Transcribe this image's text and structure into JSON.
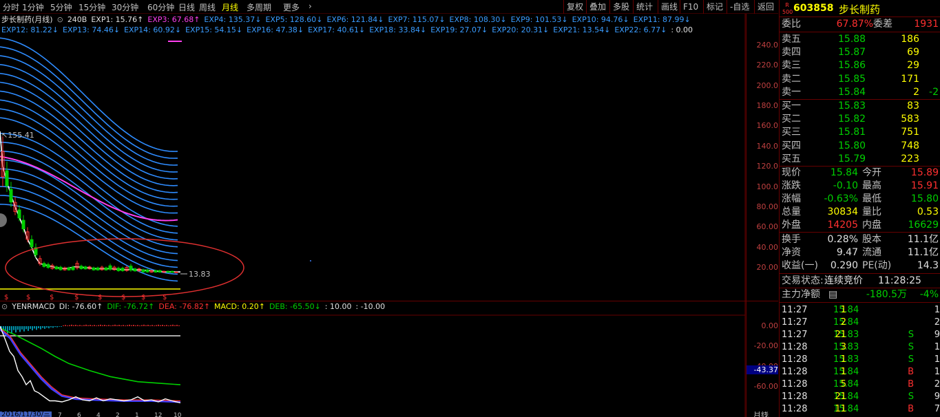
{
  "toolbar": {
    "periods": [
      "分时",
      "1分钟",
      "5分钟",
      "15分钟",
      "30分钟",
      "60分钟",
      "日线",
      "周线",
      "月线",
      "多周期",
      "更多"
    ],
    "active": "月线",
    "more_arrow": "›",
    "right": [
      "复权",
      "叠加",
      "多股",
      "统计",
      "画线",
      "F10",
      "标记",
      "-自选",
      "返回"
    ]
  },
  "main_legend": {
    "name": "步长制药(月线)",
    "count": "240B",
    "items": [
      {
        "t": "EXP1: 15.76↑",
        "c": "white"
      },
      {
        "t": "EXP3: 67.68↑",
        "c": "mag"
      },
      {
        "t": "EXP4: 135.37↓",
        "c": "blue"
      },
      {
        "t": "EXP5: 128.60↓",
        "c": "blue"
      },
      {
        "t": "EXP6: 121.84↓",
        "c": "blue"
      },
      {
        "t": "EXP7: 115.07↓",
        "c": "blue"
      },
      {
        "t": "EXP8: 108.30↓",
        "c": "blue"
      },
      {
        "t": "EXP9: 101.53↓",
        "c": "blue"
      },
      {
        "t": "EXP10: 94.76↓",
        "c": "blue"
      },
      {
        "t": "EXP11: 87.99↓",
        "c": "blue"
      }
    ],
    "items2": [
      {
        "t": "EXP12: 81.22↓",
        "c": "blue"
      },
      {
        "t": "EXP13: 74.46↓",
        "c": "blue"
      },
      {
        "t": "EXP14: 60.92↓",
        "c": "blue"
      },
      {
        "t": "EXP15: 54.15↓",
        "c": "blue"
      },
      {
        "t": "EXP16: 47.38↓",
        "c": "blue"
      },
      {
        "t": "EXP17: 40.61↓",
        "c": "blue"
      },
      {
        "t": "EXP18: 33.84↓",
        "c": "blue"
      },
      {
        "t": "EXP19: 27.07↓",
        "c": "blue"
      },
      {
        "t": "EXP20: 20.31↓",
        "c": "blue"
      },
      {
        "t": "EXP21: 13.54↓",
        "c": "blue"
      },
      {
        "t": "EXP22: 6.77↓",
        "c": "blue"
      },
      {
        "t": ": 0.00",
        "c": "white"
      }
    ]
  },
  "main_axis": [
    "240.0",
    "220.0",
    "200.0",
    "180.0",
    "160.0",
    "140.0",
    "120.0",
    "100.0",
    "80.00",
    "60.00",
    "40.00",
    "20.00"
  ],
  "high_label": "155.41",
  "low_label": "13.83",
  "sub_legend": {
    "name": "YENRMACD",
    "items": [
      {
        "t": "DI: -76.60↑",
        "c": "white"
      },
      {
        "t": "DIF: -76.72↑",
        "c": "grn"
      },
      {
        "t": "DEA: -76.82↑",
        "c": "red"
      },
      {
        "t": "MACD: 0.20↑",
        "c": "yel"
      },
      {
        "t": "DEB: -65.50↓",
        "c": "grn"
      },
      {
        "t": ": 10.00",
        "c": "white"
      },
      {
        "t": ": -10.00",
        "c": "white"
      }
    ]
  },
  "sub_axis": [
    "0.00",
    "-20.00",
    "-40.00",
    "-60.00"
  ],
  "sub_current": "-43.37",
  "date_label": "2016/11/30/三",
  "bottom_period": "月线",
  "quote": {
    "code": "603858",
    "name": "步长制药",
    "badge_top": "R",
    "badge_bot": "500",
    "weibi_l": "委比",
    "weibi_v": "67.87%",
    "weicha_l": "委差",
    "weicha_v": "1931",
    "sells": [
      {
        "l": "卖五",
        "p": "15.88",
        "v": "186",
        "x": ""
      },
      {
        "l": "卖四",
        "p": "15.87",
        "v": "69",
        "x": ""
      },
      {
        "l": "卖三",
        "p": "15.86",
        "v": "29",
        "x": ""
      },
      {
        "l": "卖二",
        "p": "15.85",
        "v": "171",
        "x": ""
      },
      {
        "l": "卖一",
        "p": "15.84",
        "v": "2",
        "x": "-2"
      }
    ],
    "buys": [
      {
        "l": "买一",
        "p": "15.83",
        "v": "83"
      },
      {
        "l": "买二",
        "p": "15.82",
        "v": "583"
      },
      {
        "l": "买三",
        "p": "15.81",
        "v": "751"
      },
      {
        "l": "买四",
        "p": "15.80",
        "v": "748"
      },
      {
        "l": "买五",
        "p": "15.79",
        "v": "223"
      }
    ],
    "stats": [
      {
        "l1": "现价",
        "v1": "15.84",
        "c1": "grn",
        "l2": "今开",
        "v2": "15.89",
        "c2": "red"
      },
      {
        "l1": "涨跌",
        "v1": "-0.10",
        "c1": "grn",
        "l2": "最高",
        "v2": "15.91",
        "c2": "red"
      },
      {
        "l1": "涨幅",
        "v1": "-0.63%",
        "c1": "grn",
        "l2": "最低",
        "v2": "15.80",
        "c2": "grn"
      },
      {
        "l1": "总量",
        "v1": "30834",
        "c1": "yel",
        "l2": "量比",
        "v2": "0.53",
        "c2": "yel"
      },
      {
        "l1": "外盘",
        "v1": "14205",
        "c1": "red",
        "l2": "内盘",
        "v2": "16629",
        "c2": "grn"
      }
    ],
    "stats2": [
      {
        "l1": "换手",
        "v1": "0.28%",
        "l2": "股本",
        "v2": "11.1亿"
      },
      {
        "l1": "净资",
        "v1": "9.47",
        "l2": "流通",
        "v2": "11.1亿"
      },
      {
        "l1": "收益(一)",
        "v1": "0.290",
        "l2": "PE(动)",
        "v2": "14.3"
      }
    ],
    "trade_state_l": "交易状态:",
    "trade_state_v": "连续竞价",
    "trade_time": "11:28:25",
    "zhuli_l": "主力净额",
    "zhuli_v": "-180.5万",
    "zhuli_p": "-4%"
  },
  "ticks": [
    {
      "t": "11:27",
      "p": "15.84",
      "v": "1",
      "f": "",
      "n": "1"
    },
    {
      "t": "11:27",
      "p": "15.84",
      "v": "2",
      "f": "",
      "n": "2"
    },
    {
      "t": "11:27",
      "p": "15.83",
      "v": "21",
      "f": "S",
      "n": "9"
    },
    {
      "t": "11:28",
      "p": "15.83",
      "v": "3",
      "f": "S",
      "n": "1"
    },
    {
      "t": "11:28",
      "p": "15.83",
      "v": "1",
      "f": "S",
      "n": "1"
    },
    {
      "t": "11:28",
      "p": "15.84",
      "v": "1",
      "f": "B",
      "n": "1"
    },
    {
      "t": "11:28",
      "p": "15.84",
      "v": "5",
      "f": "B",
      "n": "2"
    },
    {
      "t": "11:28",
      "p": "15.84",
      "v": "21",
      "f": "S",
      "n": "9"
    },
    {
      "t": "11:28",
      "p": "15.84",
      "v": "11",
      "f": "B",
      "n": "7"
    }
  ],
  "colors": {
    "up": "#ff3030",
    "down": "#00d000",
    "ema": "#2e8cff",
    "ema3": "#ff3ff0",
    "bg": "#000000",
    "grid": "#660000"
  }
}
